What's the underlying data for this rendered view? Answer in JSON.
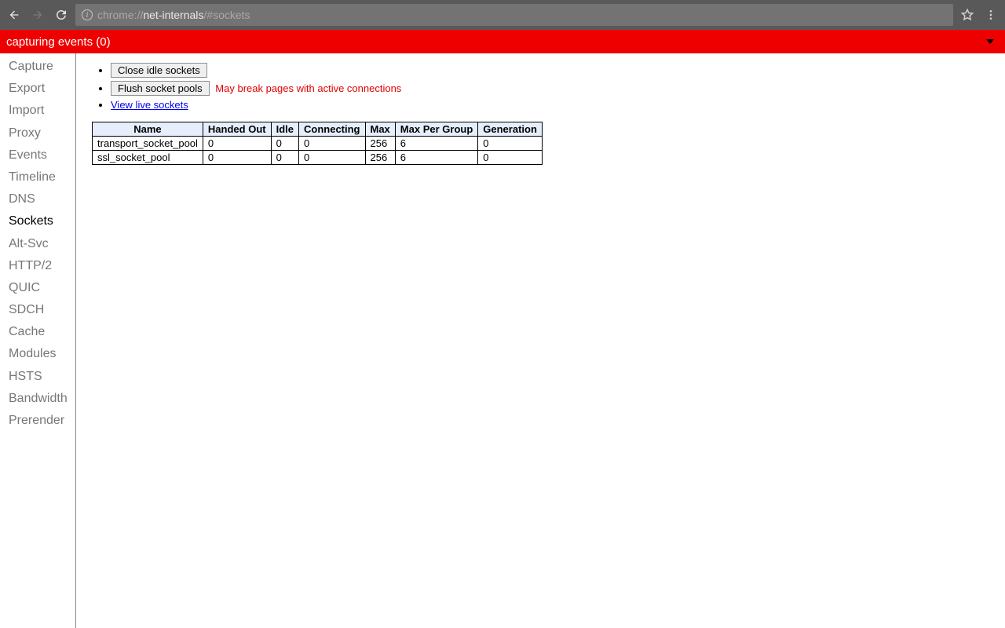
{
  "browser": {
    "url_prefix": "chrome://",
    "url_host": "net-internals",
    "url_suffix": "/#sockets"
  },
  "capture_bar": {
    "text": "capturing events (0)"
  },
  "sidebar": {
    "items": [
      {
        "label": "Capture",
        "active": false
      },
      {
        "label": "Export",
        "active": false
      },
      {
        "label": "Import",
        "active": false
      },
      {
        "label": "Proxy",
        "active": false
      },
      {
        "label": "Events",
        "active": false
      },
      {
        "label": "Timeline",
        "active": false
      },
      {
        "label": "DNS",
        "active": false
      },
      {
        "label": "Sockets",
        "active": true
      },
      {
        "label": "Alt-Svc",
        "active": false
      },
      {
        "label": "HTTP/2",
        "active": false
      },
      {
        "label": "QUIC",
        "active": false
      },
      {
        "label": "SDCH",
        "active": false
      },
      {
        "label": "Cache",
        "active": false
      },
      {
        "label": "Modules",
        "active": false
      },
      {
        "label": "HSTS",
        "active": false
      },
      {
        "label": "Bandwidth",
        "active": false
      },
      {
        "label": "Prerender",
        "active": false
      }
    ]
  },
  "actions": {
    "close_idle": "Close idle sockets",
    "flush_pools": "Flush socket pools",
    "flush_warning": "May break pages with active connections",
    "view_live": "View live sockets"
  },
  "table": {
    "headers": [
      "Name",
      "Handed Out",
      "Idle",
      "Connecting",
      "Max",
      "Max Per Group",
      "Generation"
    ],
    "rows": [
      {
        "c0": "transport_socket_pool",
        "c1": "0",
        "c2": "0",
        "c3": "0",
        "c4": "256",
        "c5": "6",
        "c6": "0"
      },
      {
        "c0": "ssl_socket_pool",
        "c1": "0",
        "c2": "0",
        "c3": "0",
        "c4": "256",
        "c5": "6",
        "c6": "0"
      }
    ]
  }
}
